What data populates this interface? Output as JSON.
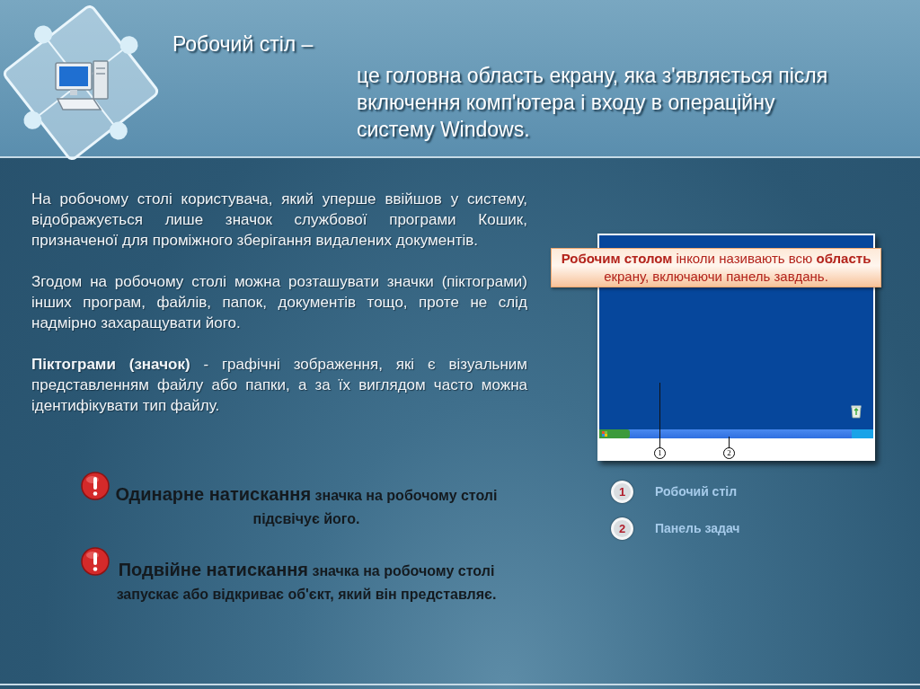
{
  "header": {
    "title": "Робочий стіл –",
    "definition": "це головна область екрану, яка з'являється після включення комп'ютера і входу в операційну систему Windows."
  },
  "paragraphs": [
    "На робочому столі користувача, який уперше ввійшов у систему, відображується лише значок службової програми Кошик, призначеної для проміжного зберігання видалених документів.",
    "Згодом на робочому столі можна розташувати значки (піктограми) інших програм, файлів, папок, документів тощо, проте не слід надмірно захаращувати його.",
    "**Піктограми (значок)** - графічні зображення, які є візуальним представленням файлу або папки, а за їх виглядом часто можна ідентифікувати тип файлу."
  ],
  "screenshot": {
    "callout": "**Робочим столом** інколи називають всю **область** екрану, включаючи панель завдань.",
    "markers": [
      "1",
      "2"
    ]
  },
  "legend": [
    {
      "number": "1",
      "label": "Робочий стіл"
    },
    {
      "number": "2",
      "label": "Панель задач"
    }
  ],
  "notes": [
    {
      "lead": "Одинарне натискання",
      "text": "значка на робочому столі підсвічує його."
    },
    {
      "lead": "Подвійне натискання",
      "text": "значка на робочому столі запускає або відкриває об'єкт, який він представляє."
    }
  ]
}
